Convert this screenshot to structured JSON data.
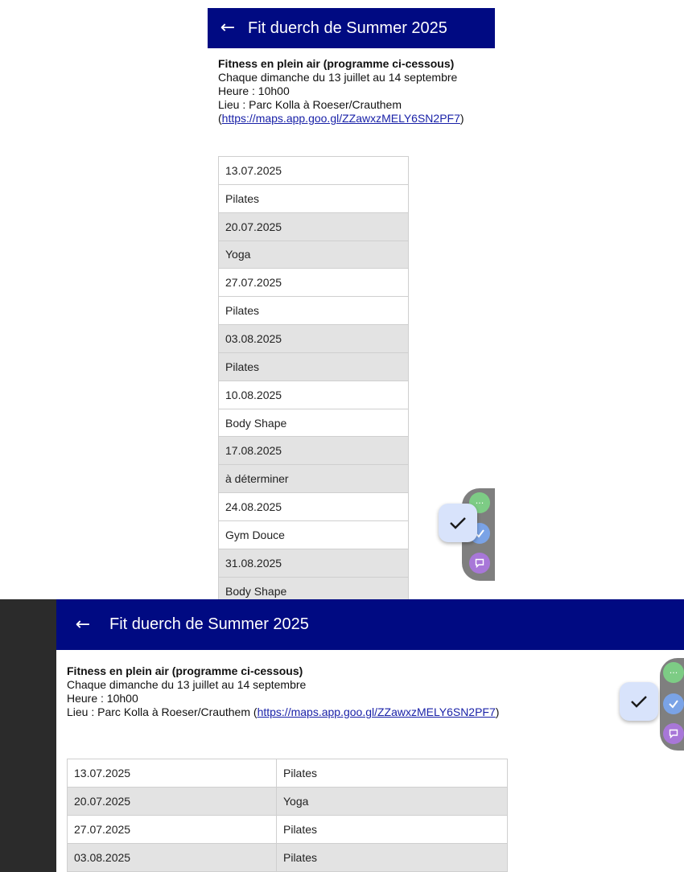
{
  "app": {
    "title": "Fit duerch de Summer 2025",
    "back_icon": "arrow-left-icon",
    "accent": "#000a82"
  },
  "info": {
    "heading": "Fitness en plein air (programme ci-cessous)",
    "line1": "Chaque dimanche du 13 juillet au 14 septembre",
    "line2": "Heure : 10h00",
    "location": "Lieu : Parc Kolla à Roeser/Crauthem",
    "link": "https://maps.app.goo.gl/ZZawxzMELY6SN2PF7"
  },
  "schedule_portrait": [
    "13.07.2025",
    "Pilates",
    "20.07.2025",
    "Yoga",
    "27.07.2025",
    "Pilates",
    "03.08.2025",
    "Pilates",
    "10.08.2025",
    "Body Shape",
    "17.08.2025",
    "à déterminer",
    "24.08.2025",
    "Gym Douce",
    "31.08.2025",
    "Body Shape"
  ],
  "schedule_landscape": [
    {
      "date": "13.07.2025",
      "activity": "Pilates"
    },
    {
      "date": "20.07.2025",
      "activity": "Yoga"
    },
    {
      "date": "27.07.2025",
      "activity": "Pilates"
    },
    {
      "date": "03.08.2025",
      "activity": "Pilates"
    },
    {
      "date": "",
      "activity": ""
    }
  ],
  "widgets": {
    "more_icon": "ellipsis-icon",
    "check_icon": "checkmark-icon",
    "chat_icon": "chat-bubble-icon",
    "more_symbol": "···"
  }
}
